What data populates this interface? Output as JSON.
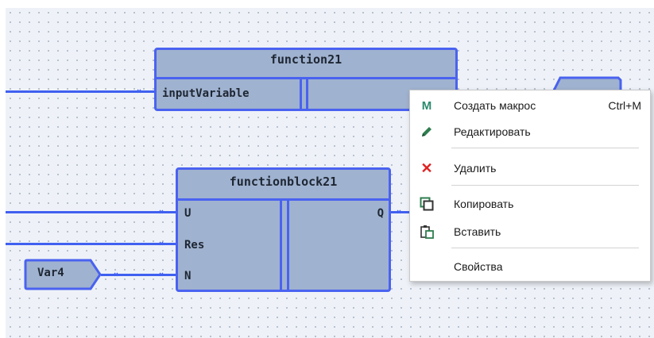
{
  "colors": {
    "wire": "#4060f0",
    "block_fill": "#9fb2cf",
    "block_border": "#4a62f0",
    "canvas": "#eef2f8"
  },
  "blocks": {
    "function21": {
      "title": "function21",
      "input_port": "inputVariable"
    },
    "functionblock21": {
      "title": "functionblock21",
      "inputs": [
        "U",
        "Res",
        "N"
      ],
      "output": "Q"
    }
  },
  "variables": {
    "var4": "Var4"
  },
  "context_menu": {
    "items": [
      {
        "icon": "macro-m-icon",
        "glyph": "M",
        "label": "Создать макрос",
        "shortcut": "Ctrl+M"
      },
      {
        "icon": "pencil-icon",
        "label": "Редактировать"
      },
      {
        "icon": "delete-x-icon",
        "glyph": "✕",
        "label": "Удалить"
      },
      {
        "icon": "copy-icon",
        "label": "Копировать"
      },
      {
        "icon": "paste-icon",
        "label": "Вставить"
      },
      {
        "icon": "none",
        "label": "Свойства"
      }
    ]
  }
}
